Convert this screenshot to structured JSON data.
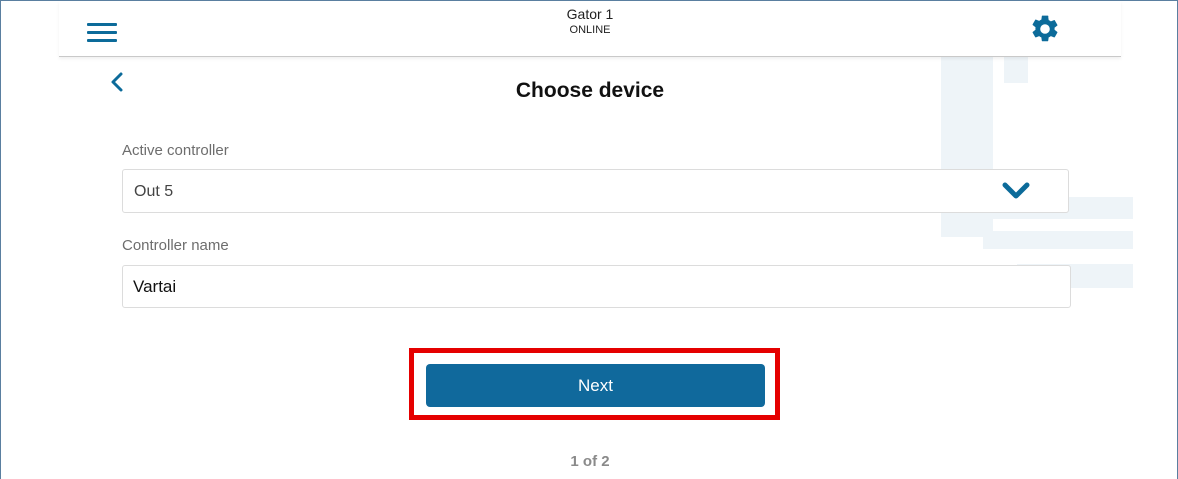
{
  "header": {
    "device_name": "Gator 1",
    "device_status": "ONLINE"
  },
  "page": {
    "title": "Choose device"
  },
  "form": {
    "active_controller_label": "Active controller",
    "active_controller_value": "Out 5",
    "controller_name_label": "Controller name",
    "controller_name_value": "Vartai"
  },
  "actions": {
    "next_label": "Next"
  },
  "pager": {
    "text": "1 of 2"
  },
  "colors": {
    "accent": "#10699c",
    "icon": "#0c6b9a",
    "highlight": "#e50000"
  },
  "icons": [
    "hamburger-menu-icon",
    "gear-icon",
    "chevron-left-icon",
    "chevron-down-icon"
  ]
}
